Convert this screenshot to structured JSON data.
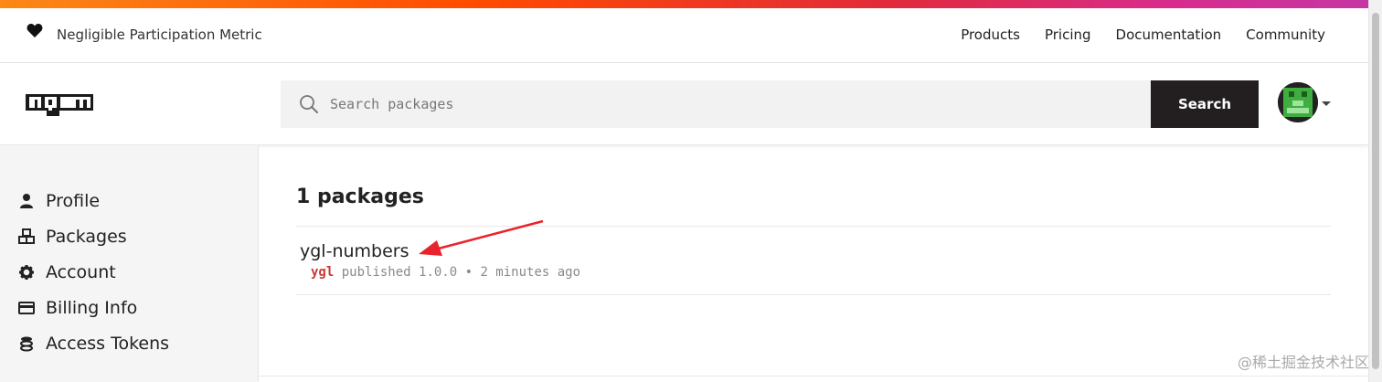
{
  "top_header": {
    "tagline": "Negligible Participation Metric",
    "nav": [
      "Products",
      "Pricing",
      "Documentation",
      "Community"
    ]
  },
  "search": {
    "placeholder": "Search packages",
    "button_label": "Search"
  },
  "sidebar": {
    "items": [
      {
        "label": "Profile",
        "icon": "user-icon"
      },
      {
        "label": "Packages",
        "icon": "packages-icon"
      },
      {
        "label": "Account",
        "icon": "gear-icon"
      },
      {
        "label": "Billing Info",
        "icon": "credit-card-icon"
      },
      {
        "label": "Access Tokens",
        "icon": "tokens-icon"
      }
    ]
  },
  "main": {
    "title": "1 packages",
    "packages": [
      {
        "name": "ygl-numbers",
        "publisher": "ygl",
        "meta": " published 1.0.0 • 2 minutes ago"
      }
    ]
  },
  "watermark": "@稀土掘金技术社区",
  "colors": {
    "brand_red": "#cb3837",
    "search_button": "#231f20",
    "annotation_arrow": "#e8232b"
  }
}
